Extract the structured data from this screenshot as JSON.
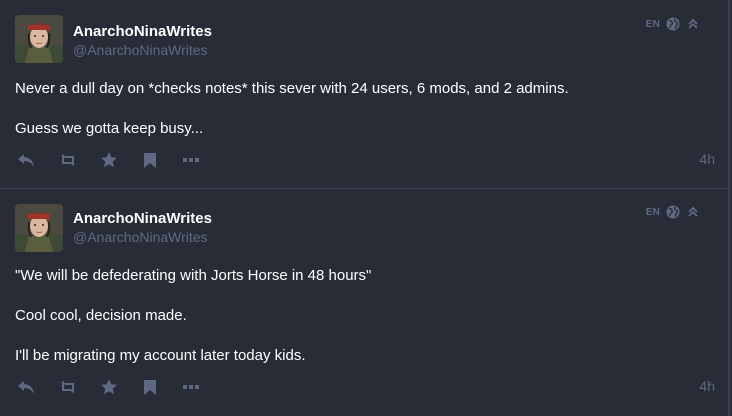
{
  "posts": [
    {
      "display_name": "AnarchoNinaWrites",
      "handle": "@AnarchoNinaWrites",
      "language": "EN",
      "visibility_icon": "globe-icon",
      "collapse_icon": "chevrons-up-icon",
      "paragraphs": [
        "Never a dull day on *checks notes* this sever with 24 users, 6 mods, and 2 admins.",
        "Guess we gotta keep busy..."
      ],
      "time": "4h"
    },
    {
      "display_name": "AnarchoNinaWrites",
      "handle": "@AnarchoNinaWrites",
      "language": "EN",
      "visibility_icon": "globe-icon",
      "collapse_icon": "chevrons-up-icon",
      "paragraphs": [
        "\"We will be defederating with Jorts Horse in 48 hours\"",
        "Cool cool, decision made.",
        "I'll be migrating my account later today kids."
      ],
      "time": "4h"
    }
  ],
  "action_icons": [
    "reply-icon",
    "boost-icon",
    "favourite-icon",
    "bookmark-icon",
    "more-icon"
  ],
  "colors": {
    "background": "#282c37",
    "divider": "#393f4f",
    "muted": "#606984",
    "text": "#ffffff"
  }
}
